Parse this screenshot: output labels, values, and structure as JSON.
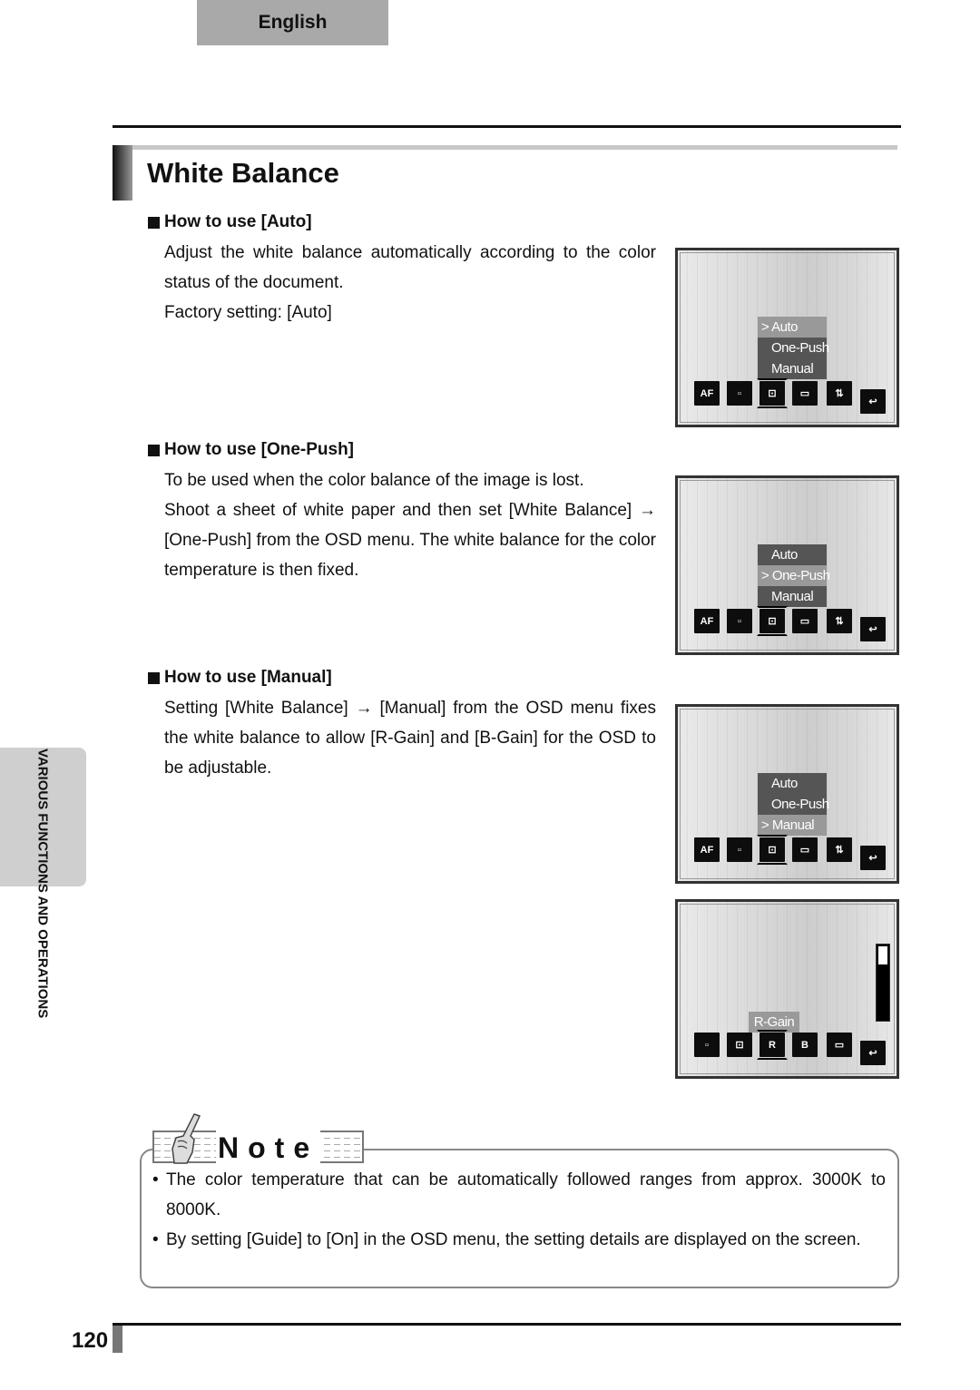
{
  "header": {
    "language_tab": "English"
  },
  "page": {
    "title": "White Balance",
    "number": "120"
  },
  "sections": [
    {
      "heading": "How to use [Auto]",
      "paragraphs": [
        "Adjust the white balance automatically according to the color status of the document.",
        "Factory setting: [Auto]"
      ]
    },
    {
      "heading": "How to use [One-Push]",
      "paragraphs": [
        "To be used when the color balance of the image is lost.",
        "Shoot a sheet of white paper and then set [White Balance] → [One-Push] from the OSD menu. The white balance for the color temperature is then fixed."
      ]
    },
    {
      "heading": "How to use [Manual]",
      "paragraphs": [
        "Setting [White Balance] → [Manual] from the OSD menu fixes the white balance to allow [R-Gain] and [B-Gain] for the OSD to be adjustable."
      ]
    }
  ],
  "osd_screens": [
    {
      "menu": [
        "> Auto",
        "One-Push",
        "Manual"
      ],
      "selected": 0
    },
    {
      "menu": [
        "Auto",
        "> One-Push",
        "Manual"
      ],
      "selected": 1
    },
    {
      "menu": [
        "Auto",
        "One-Push",
        "> Manual"
      ],
      "selected": 2
    },
    {
      "gain_label": "R-Gain",
      "gain_level_fraction": 0.25
    }
  ],
  "osd_icons": {
    "menu_icons": [
      "af-icon",
      "focus-frame-icon",
      "white-balance-icon",
      "monitor-icon",
      "image-swap-icon",
      "return-icon"
    ],
    "gain_icons": [
      "focus-frame-icon",
      "white-balance-icon",
      "r-gain-icon",
      "b-gain-icon",
      "monitor-icon",
      "return-icon"
    ],
    "af_text": "AF",
    "r_text": "R",
    "b_text": "B"
  },
  "side_tab": {
    "label": "VARIOUS FUNCTIONS AND OPERATIONS"
  },
  "note": {
    "title": "Note",
    "items": [
      "The color temperature that can be automatically followed ranges from approx. 3000K to 8000K.",
      "By setting [Guide] to [On] in the OSD menu, the setting details are displayed on the screen."
    ]
  }
}
